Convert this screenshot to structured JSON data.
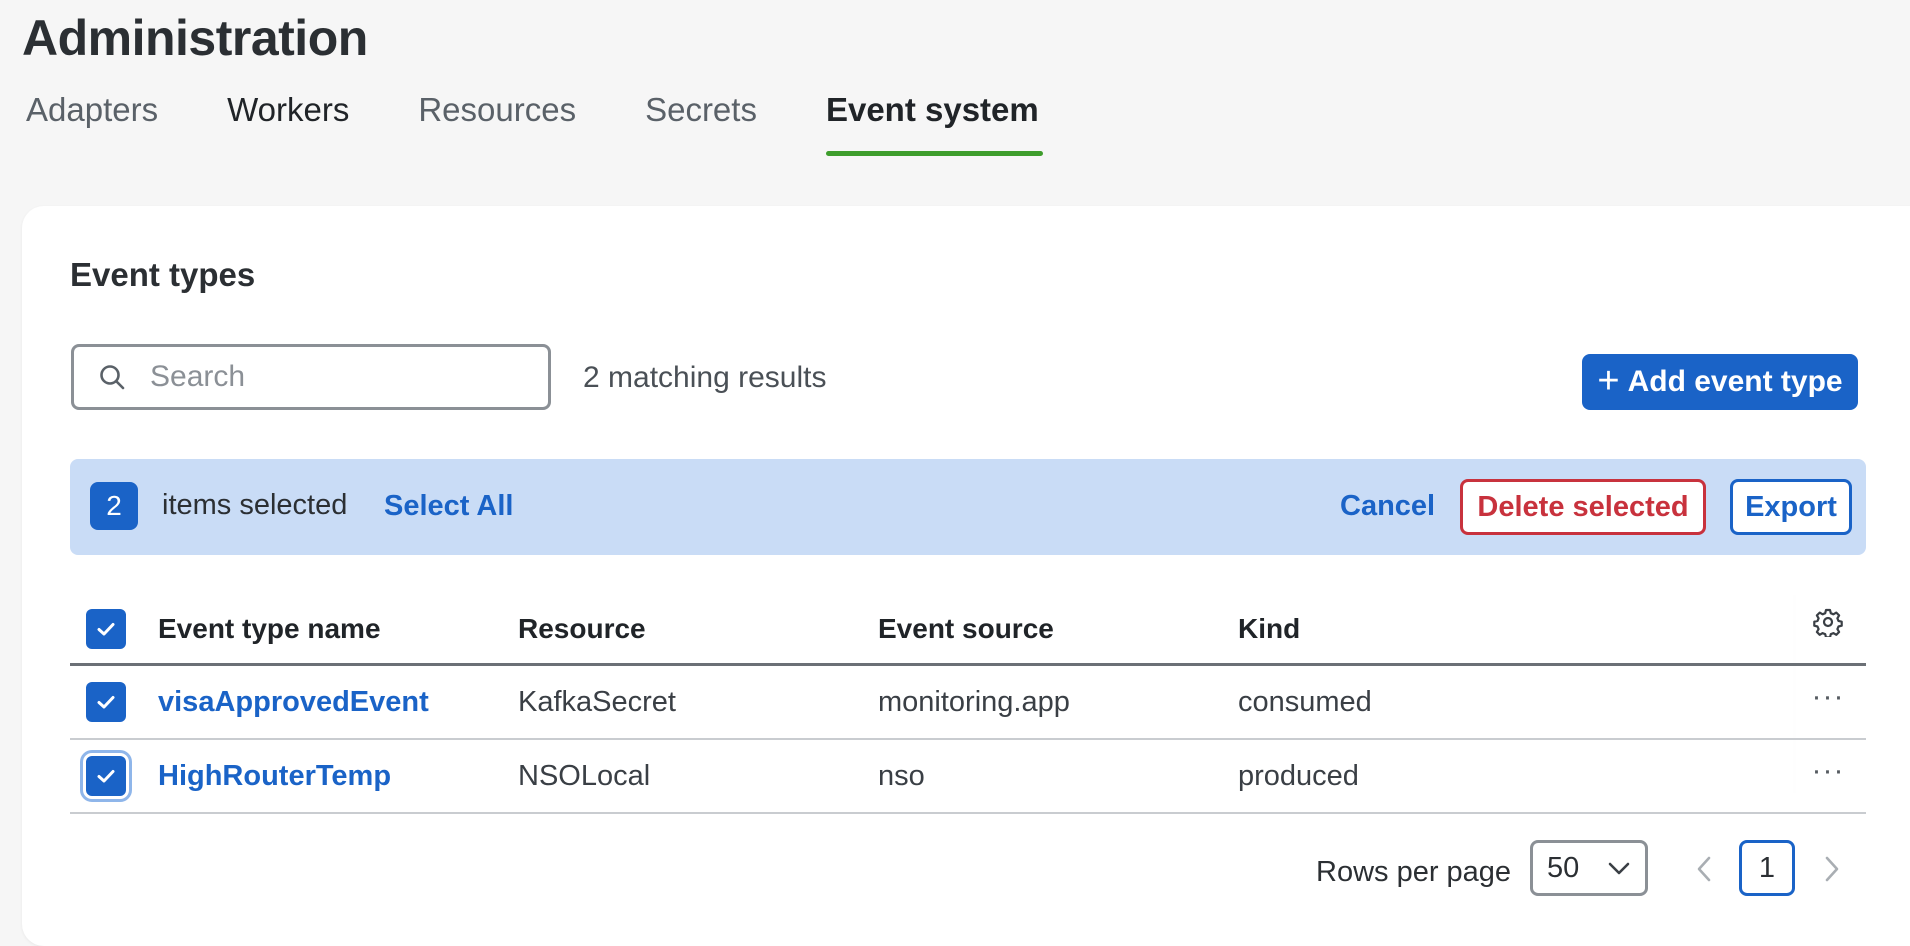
{
  "page": {
    "title": "Administration"
  },
  "tabs": [
    {
      "label": "Adapters",
      "active": false
    },
    {
      "label": "Workers",
      "active": false
    },
    {
      "label": "Resources",
      "active": false
    },
    {
      "label": "Secrets",
      "active": false
    },
    {
      "label": "Event system",
      "active": true
    }
  ],
  "colors": {
    "accent": "#1a63c7",
    "active_tab_underline": "#3e9d2c",
    "danger": "#c8323d",
    "selection_bar_bg": "#c9dcf6"
  },
  "event_types": {
    "title": "Event types",
    "search": {
      "placeholder": "Search",
      "value": "",
      "icon": "search-icon"
    },
    "matching_results": "2 matching results",
    "add_button": {
      "icon": "plus-icon",
      "label": "Add event type"
    }
  },
  "selection": {
    "count": "2",
    "text": "items selected",
    "select_all": "Select All",
    "cancel": "Cancel",
    "delete": "Delete selected",
    "export": "Export"
  },
  "table": {
    "headers": {
      "name": "Event type name",
      "resource": "Resource",
      "source": "Event source",
      "kind": "Kind",
      "settings_icon": "gear-icon"
    },
    "rows": [
      {
        "name": "visaApprovedEvent",
        "resource": "KafkaSecret",
        "source": "monitoring.app",
        "kind": "consumed",
        "checked": true
      },
      {
        "name": "HighRouterTemp",
        "resource": "NSOLocal",
        "source": "nso",
        "kind": "produced",
        "checked": true
      }
    ],
    "row_action_icon": "more-horizontal-icon"
  },
  "pagination": {
    "rows_per_page_label": "Rows per page",
    "rows_per_page_value": "50",
    "current_page": "1"
  }
}
